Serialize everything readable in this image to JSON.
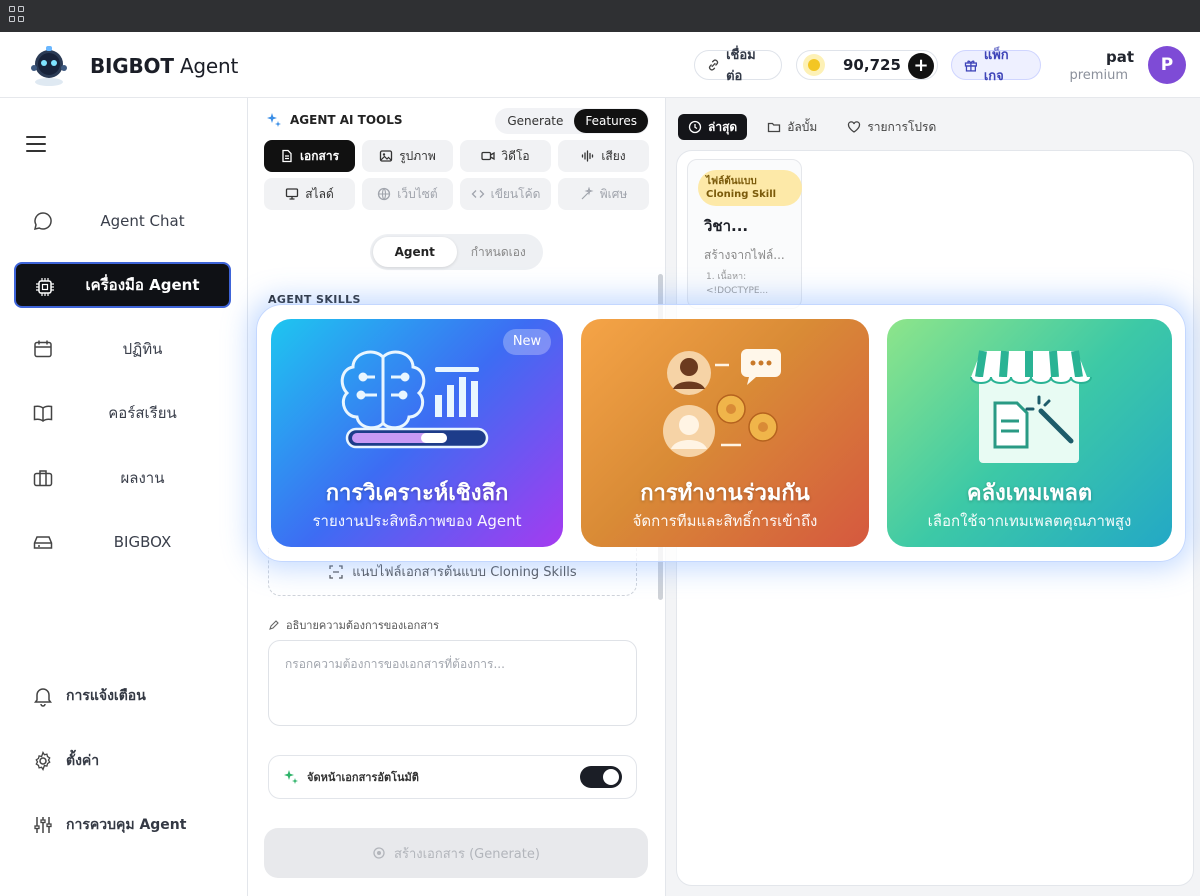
{
  "header": {
    "brand_bold": "BIGBOT",
    "brand_rest": " Agent",
    "connect_label": "เชื่อมต่อ",
    "coins": "90,725",
    "add_label": "+",
    "package_label": "แพ็กเกจ",
    "user_name": "pat",
    "user_plan": "premium",
    "avatar_letter": "P"
  },
  "sidebar": {
    "items": [
      {
        "label": "Agent Chat",
        "icon": "chat-icon"
      },
      {
        "label": "เครื่องมือ Agent",
        "icon": "chip-icon",
        "active": true
      },
      {
        "label": "ปฏิทิน",
        "icon": "calendar-icon"
      },
      {
        "label": "คอร์สเรียน",
        "icon": "book-icon"
      },
      {
        "label": "ผลงาน",
        "icon": "briefcase-icon"
      },
      {
        "label": "BIGBOX",
        "icon": "box-icon"
      }
    ],
    "bottom": [
      {
        "label": "การแจ้งเตือน",
        "icon": "bell-icon"
      },
      {
        "label": "ตั้งค่า",
        "icon": "gear-icon"
      },
      {
        "label": "การควบคุม Agent",
        "icon": "sliders-icon"
      }
    ]
  },
  "tools": {
    "title": "AGENT AI TOOLS",
    "seg": [
      "Generate",
      "Features"
    ],
    "buttons": [
      "เอกสาร",
      "รูปภาพ",
      "วิดีโอ",
      "เสียง",
      "สไลด์",
      "เว็บไซต์",
      "เขียนโค้ด",
      "พิเศษ"
    ],
    "mode": [
      "Agent",
      "กำหนดเอง"
    ],
    "skills_label": "AGENT SKILLS",
    "upload_label": "แนบไฟล์เอกสารต้นแบบ Cloning Skills",
    "desc_label": "อธิบายความต้องการของเอกสาร",
    "desc_placeholder": "กรอกความต้องการของเอกสารที่ต้องการ...",
    "auto_label": "จัดหน้าเอกสารอัตโนมัติ",
    "generate_label": "สร้างเอกสาร (Generate)"
  },
  "right": {
    "tabs": [
      "ล่าสุด",
      "อัลบั้ม",
      "รายการโปรด"
    ],
    "doc": {
      "badge": "ไฟล์ต้นแบบ Cloning Skill",
      "title": "วิชา...",
      "sub": "สร้างจากไฟล์...",
      "snip1": "1. เนื้อหา:",
      "snip2": "<!DOCTYPE..."
    }
  },
  "features": [
    {
      "title": "การวิเคราะห์เชิงลึก",
      "sub": "รายงานประสิทธิภาพของ Agent",
      "badge": "New"
    },
    {
      "title": "การทำงานร่วมกัน",
      "sub": "จัดการทีมและสิทธิ์การเข้าถึง"
    },
    {
      "title": "คลังเทมเพลต",
      "sub": "เลือกใช้จากเทมเพลตคุณภาพสูง"
    }
  ],
  "colors": {
    "active_nav": "#0f1115",
    "accent": "#3e64d8",
    "avatar": "#7e4bd6",
    "coin": "#f3c623"
  }
}
